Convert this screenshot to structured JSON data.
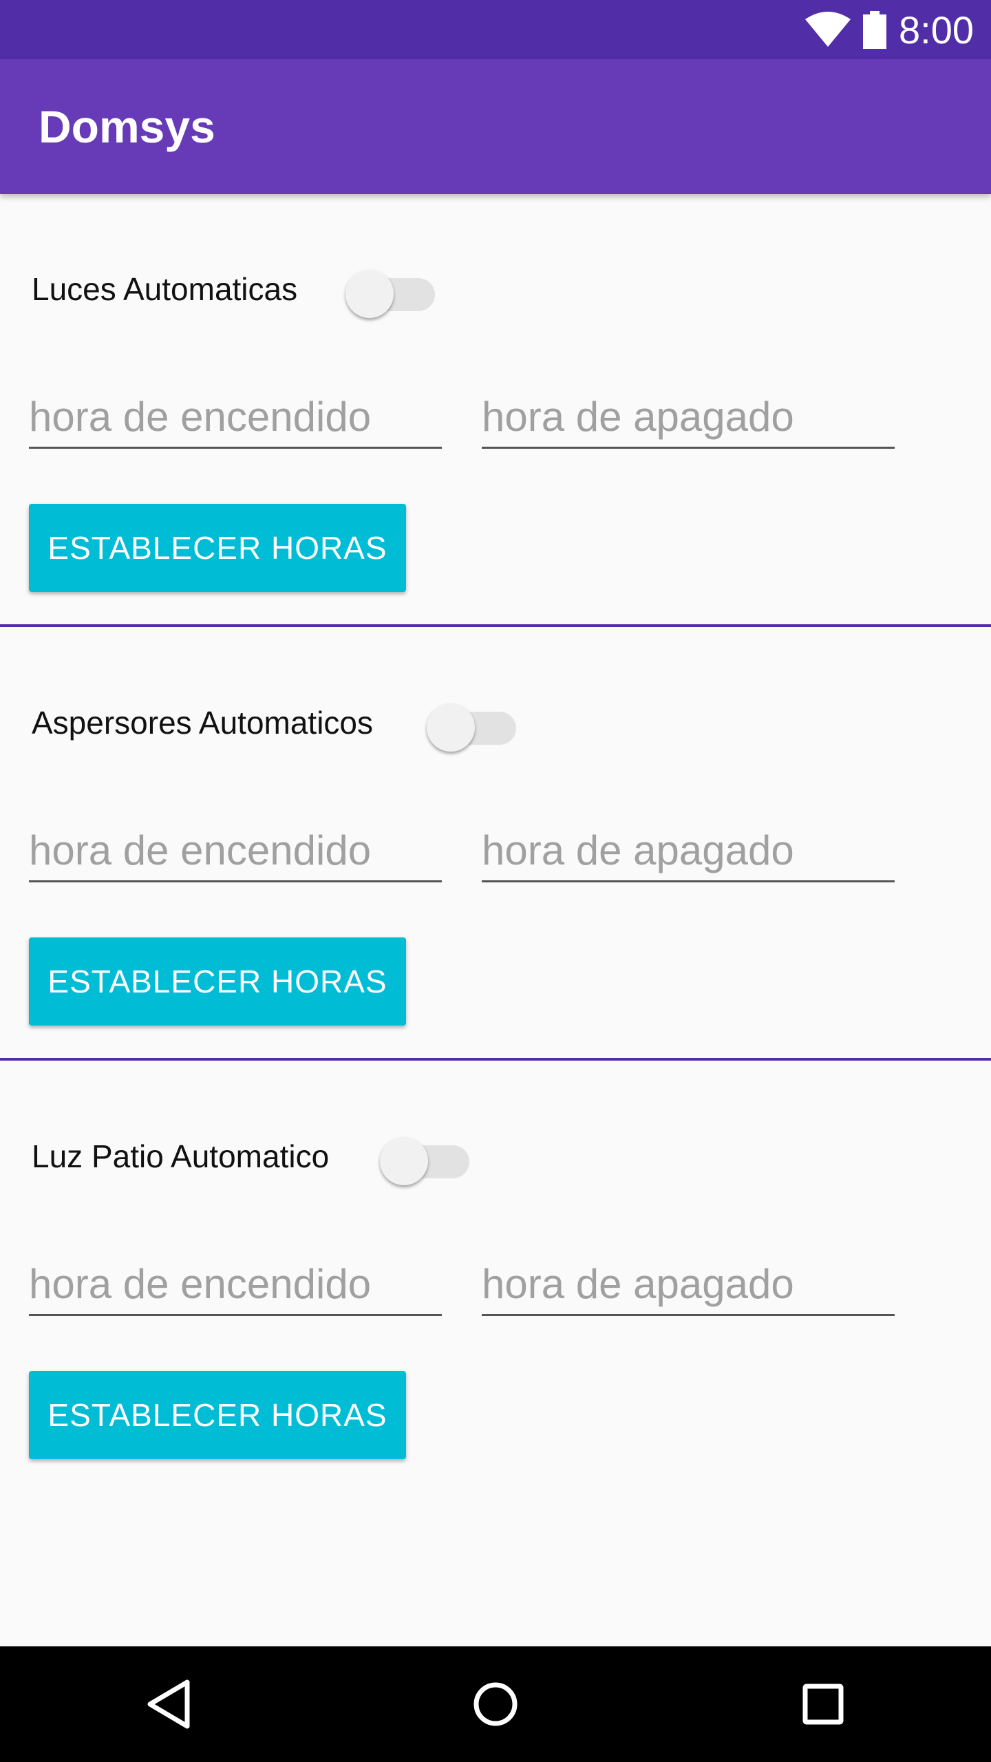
{
  "status_bar": {
    "time": "8:00",
    "wifi_icon": "wifi-icon",
    "battery_icon": "battery-icon"
  },
  "app_bar": {
    "title": "Domsys",
    "color": "#673ab7",
    "status_color": "#512da8"
  },
  "sections": [
    {
      "toggle_label": "Luces Automaticas",
      "toggle_on": false,
      "on_time_placeholder": "hora de encendido",
      "on_time_value": "",
      "off_time_placeholder": "hora de apagado",
      "off_time_value": "",
      "button_label": "ESTABLECER HORAS"
    },
    {
      "toggle_label": "Aspersores Automaticos",
      "toggle_on": false,
      "on_time_placeholder": "hora de encendido",
      "on_time_value": "",
      "off_time_placeholder": "hora de apagado",
      "off_time_value": "",
      "button_label": "ESTABLECER HORAS"
    },
    {
      "toggle_label": "Luz Patio Automatico",
      "toggle_on": false,
      "on_time_placeholder": "hora de encendido",
      "on_time_value": "",
      "off_time_placeholder": "hora de apagado",
      "off_time_value": "",
      "button_label": "ESTABLECER HORAS"
    }
  ],
  "colors": {
    "button": "#00bcd4",
    "divider": "#512da8",
    "background": "#fafafa"
  },
  "nav_bar": {
    "back_icon": "back-triangle-icon",
    "home_icon": "home-circle-icon",
    "recents_icon": "recents-square-icon"
  }
}
